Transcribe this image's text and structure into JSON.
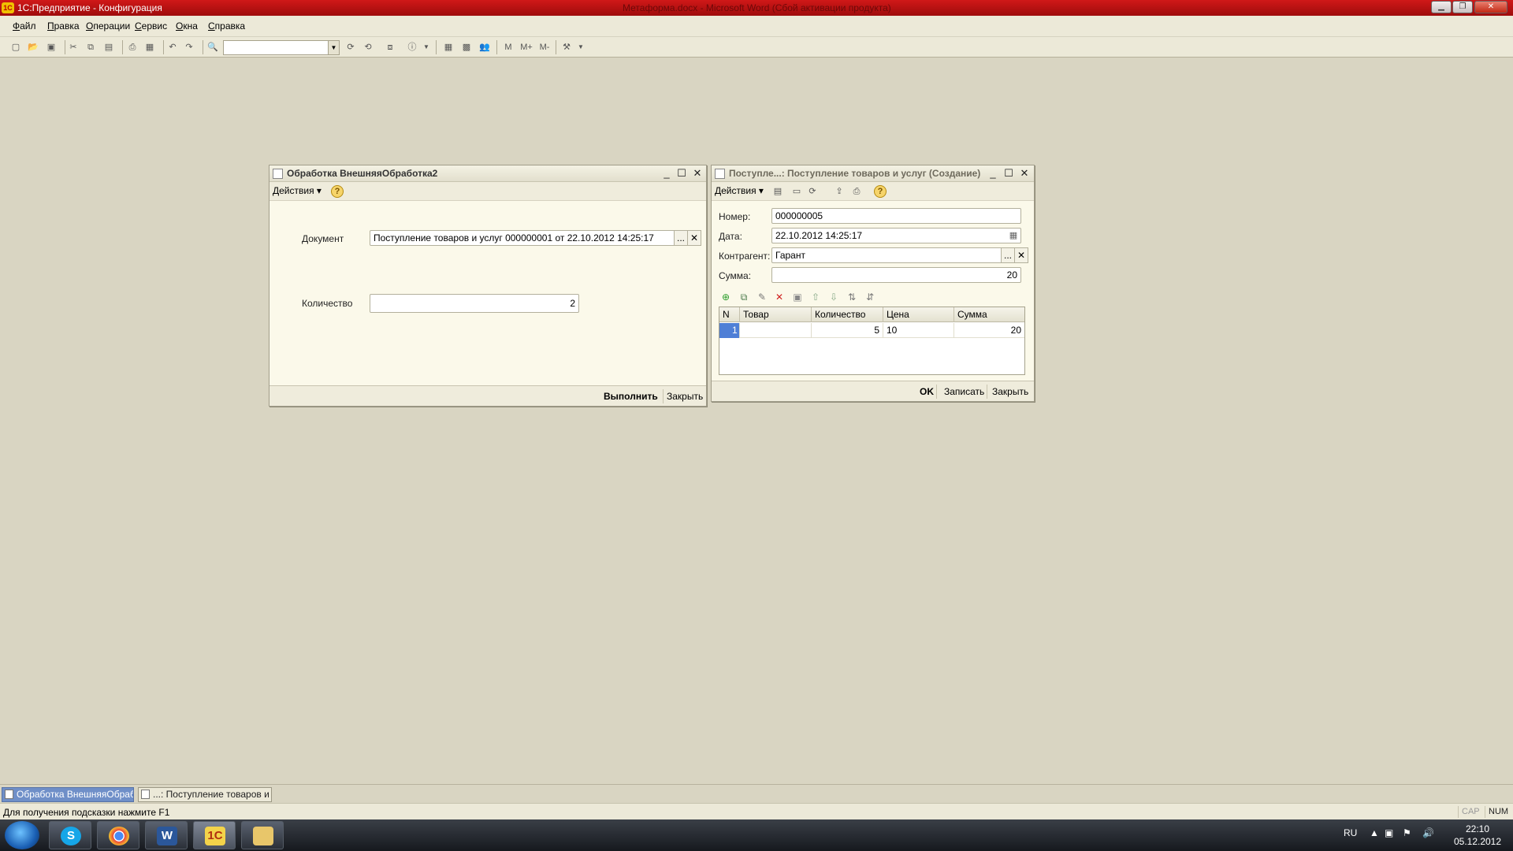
{
  "app": {
    "title": "1С:Предприятие - Конфигурация",
    "center_title": "Метаформа.docx - Microsoft Word (Сбой активации продукта)",
    "logo_text": "1С"
  },
  "menu": [
    "Файл",
    "Правка",
    "Операции",
    "Сервис",
    "Окна",
    "Справка"
  ],
  "toolbar": {
    "icons": [
      "new-icon",
      "open-icon",
      "save-icon",
      "cut-icon",
      "copy-icon",
      "paste-icon",
      "print-icon",
      "preview-icon",
      "undo-icon",
      "redo-icon",
      "find-icon"
    ],
    "m_labels": [
      "M",
      "M+",
      "M-"
    ]
  },
  "form1": {
    "title": "Обработка  ВнешняяОбработка2",
    "actions_label": "Действия ▾",
    "document_label": "Документ",
    "document_value": "Поступление товаров и услуг 000000001 от 22.10.2012 14:25:17",
    "quantity_label": "Количество",
    "quantity_value": "2",
    "execute_label": "Выполнить",
    "close_label": "Закрыть",
    "select_glyph": "...",
    "clear_glyph": "✕"
  },
  "form2": {
    "title": "Поступле...: Поступление товаров и услуг (Создание)",
    "actions_label": "Действия ▾",
    "number_label": "Номер:",
    "number_value": "000000005",
    "date_label": "Дата:",
    "date_value": "22.10.2012 14:25:17",
    "contractor_label": "Контрагент:",
    "contractor_value": "Гарант",
    "sum_label": "Сумма:",
    "sum_value": "20",
    "table": {
      "columns": [
        "N",
        "Товар",
        "Количество",
        "Цена",
        "Сумма"
      ],
      "rows": [
        {
          "n": "1",
          "product": "",
          "qty": "5",
          "price": "10",
          "sum": "20"
        }
      ]
    },
    "ok_label": "OK",
    "save_label": "Записать",
    "close_label": "Закрыть",
    "select_glyph": "...",
    "clear_glyph": "✕"
  },
  "window_tabs": [
    {
      "label": "Обработка  ВнешняяОбраб...",
      "active": true
    },
    {
      "label": "...: Поступление товаров и ...",
      "active": false
    }
  ],
  "status": {
    "hint": "Для получения подсказки нажмите F1",
    "cap": "CAP",
    "num": "NUM"
  },
  "taskbar": {
    "lang": "RU",
    "time": "22:10",
    "date": "05.12.2012"
  },
  "colors": {
    "titlebar": "#c41414",
    "workspace": "#d9d5c2",
    "form_bg": "#fbf9ea",
    "selection": "#4f7fd6"
  }
}
